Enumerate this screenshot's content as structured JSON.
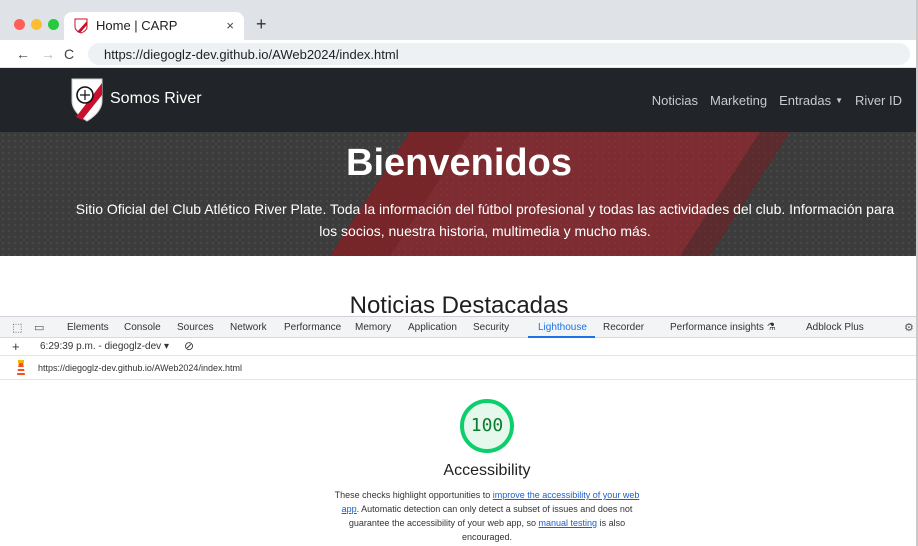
{
  "browser": {
    "tab_title": "Home | CARP",
    "tab_close": "×",
    "new_tab": "+",
    "back_icon": "←",
    "forward_icon": "→",
    "reload_icon": "C",
    "url": "https://diegoglz-dev.github.io/AWeb2024/index.html"
  },
  "site": {
    "brand": "Somos River",
    "nav": {
      "noticias": "Noticias",
      "marketing": "Marketing",
      "entradas": "Entradas",
      "river_id": "River ID"
    },
    "hero": {
      "title": "Bienvenidos",
      "subtitle": "Sitio Oficial del Club Atlético River Plate. Toda la información del fútbol profesional y todas las actividades del club. Información para los socios, nuestra historia, multimedia y mucho más."
    },
    "section_title": "Noticias Destacadas",
    "colors": {
      "navbar": "#212529",
      "accent_red": "#c8102e"
    }
  },
  "devtools": {
    "tabs": [
      "Elements",
      "Console",
      "Sources",
      "Network",
      "Performance",
      "Memory",
      "Application",
      "Security",
      "Lighthouse",
      "Recorder",
      "Performance insights",
      "Adblock Plus"
    ],
    "active_tab": "Lighthouse",
    "toolbar": {
      "add": "+",
      "report_selector": "6:29:39 p.m. - diegoglz-dev ▾",
      "clear_icon": "⊘"
    },
    "report_url": "https://diegoglz-dev.github.io/AWeb2024/index.html",
    "lighthouse": {
      "score": "100",
      "category": "Accessibility",
      "desc_before_link1": "These checks highlight opportunities to ",
      "link1": "improve the accessibility of your web app",
      "desc_middle": ". Automatic detection can only detect a subset of issues and does not guarantee the accessibility of your web app, so ",
      "link2": "manual testing",
      "desc_after": " is also encouraged.",
      "colors": {
        "pass": "#0cce6b",
        "pass_fill": "#e6f8ec"
      }
    },
    "icons": [
      "inspect-icon",
      "device-toolbar-icon",
      "settings-icon",
      "flask-icon"
    ]
  }
}
